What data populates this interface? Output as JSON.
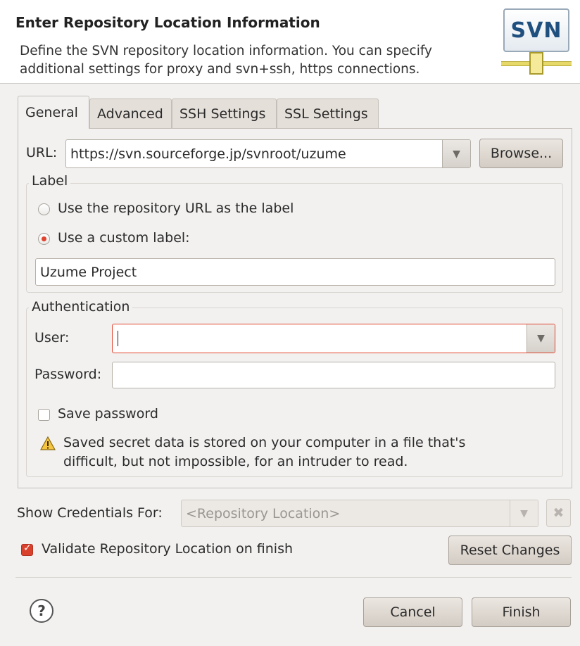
{
  "header": {
    "title": "Enter Repository Location Information",
    "description_line1": "Define the SVN repository location information. You can specify",
    "description_line2": "additional settings for proxy and svn+ssh, https connections.",
    "logo_text": "SVN"
  },
  "tabs": [
    {
      "label": "General",
      "active": true
    },
    {
      "label": "Advanced",
      "active": false
    },
    {
      "label": "SSH Settings",
      "active": false
    },
    {
      "label": "SSL Settings",
      "active": false
    }
  ],
  "url": {
    "label": "URL:",
    "value": "https://svn.sourceforge.jp/svnroot/uzume",
    "browse_label": "Browse..."
  },
  "label_group": {
    "title": "Label",
    "option_repo_url": "Use the repository URL as the label",
    "option_custom": "Use a custom label:",
    "selected": "custom",
    "custom_value": "Uzume Project"
  },
  "auth_group": {
    "title": "Authentication",
    "user_label": "User:",
    "user_value": "",
    "password_label": "Password:",
    "password_value": "",
    "save_password_label": "Save password",
    "save_password_checked": false,
    "warning_line1": "Saved secret data is stored on your computer in a file that's",
    "warning_line2": "difficult, but not impossible, for an intruder to read."
  },
  "credentials": {
    "label": "Show Credentials For:",
    "selected": "<Repository Location>",
    "enabled": false
  },
  "validate": {
    "label": "Validate Repository Location on finish",
    "checked": true
  },
  "buttons": {
    "reset": "Reset Changes",
    "cancel": "Cancel",
    "finish": "Finish"
  },
  "colors": {
    "accent_red": "#d9412c",
    "error_border": "#e0432e",
    "svn_logo_blue": "#1f4f7f"
  }
}
